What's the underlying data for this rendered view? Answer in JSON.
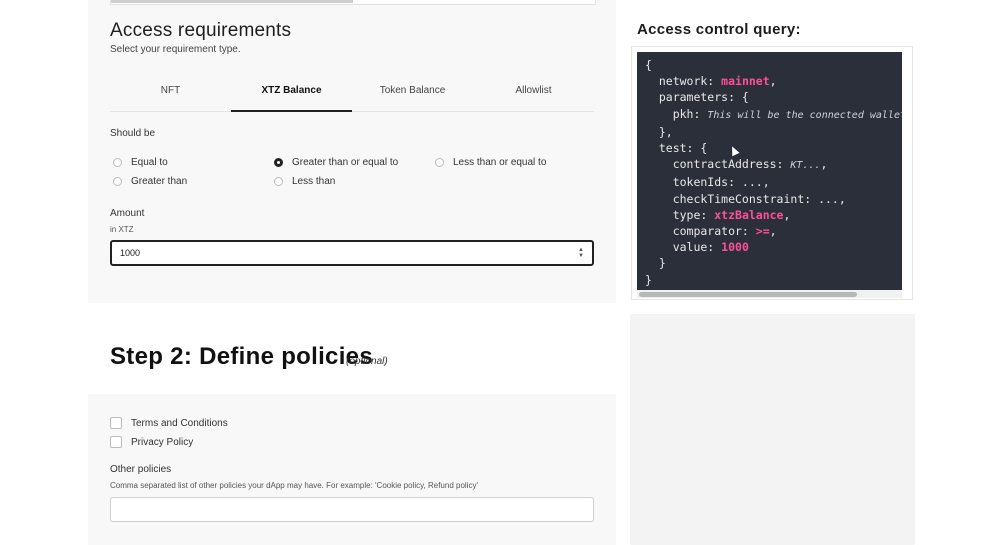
{
  "access": {
    "title": "Access requirements",
    "subtitle": "Select your requirement type.",
    "tabs": [
      {
        "label": "NFT"
      },
      {
        "label": "XTZ Balance"
      },
      {
        "label": "Token Balance"
      },
      {
        "label": "Allowlist"
      }
    ],
    "should_be_label": "Should be",
    "options": [
      {
        "label": "Equal to",
        "selected": false
      },
      {
        "label": "Greater than",
        "selected": false
      },
      {
        "label": "Greater than or equal to",
        "selected": true
      },
      {
        "label": "Less than",
        "selected": false
      },
      {
        "label": "Less than or equal to",
        "selected": false
      }
    ],
    "amount_label": "Amount",
    "amount_unit": "in XTZ",
    "amount_value": "1000"
  },
  "step2": {
    "title": "Step 2: Define policies",
    "optional": "(optional)",
    "checkboxes": [
      {
        "label": "Terms and Conditions"
      },
      {
        "label": "Privacy Policy"
      }
    ],
    "other_label": "Other policies",
    "other_help": "Comma separated list of other policies your dApp may have. For example: 'Cookie policy, Refund policy'",
    "other_value": ""
  },
  "query": {
    "title": "Access control query:",
    "lines": {
      "l1": "{",
      "l2a": "  network: ",
      "l2b": "mainnet",
      "l2c": ",",
      "l3": "  parameters: {",
      "l4a": "    pkh: ",
      "l4b": "This will be the connected wallet a",
      "l5": "  },",
      "l6": "  test: {",
      "l7a": "    contractAddress: ",
      "l7b": "KT...",
      "l7c": ",",
      "l8": "    tokenIds: ...,",
      "l9": "    checkTimeConstraint: ...,",
      "l10a": "    type: ",
      "l10b": "xtzBalance",
      "l10c": ",",
      "l11a": "    comparator: ",
      "l11b": ">=",
      "l11c": ",",
      "l12a": "    value: ",
      "l12b": "1000",
      "l13": "  }",
      "l14": "}"
    }
  },
  "colors": {
    "accent": "#ff4f9a",
    "code_bg": "#2b2f3a"
  }
}
